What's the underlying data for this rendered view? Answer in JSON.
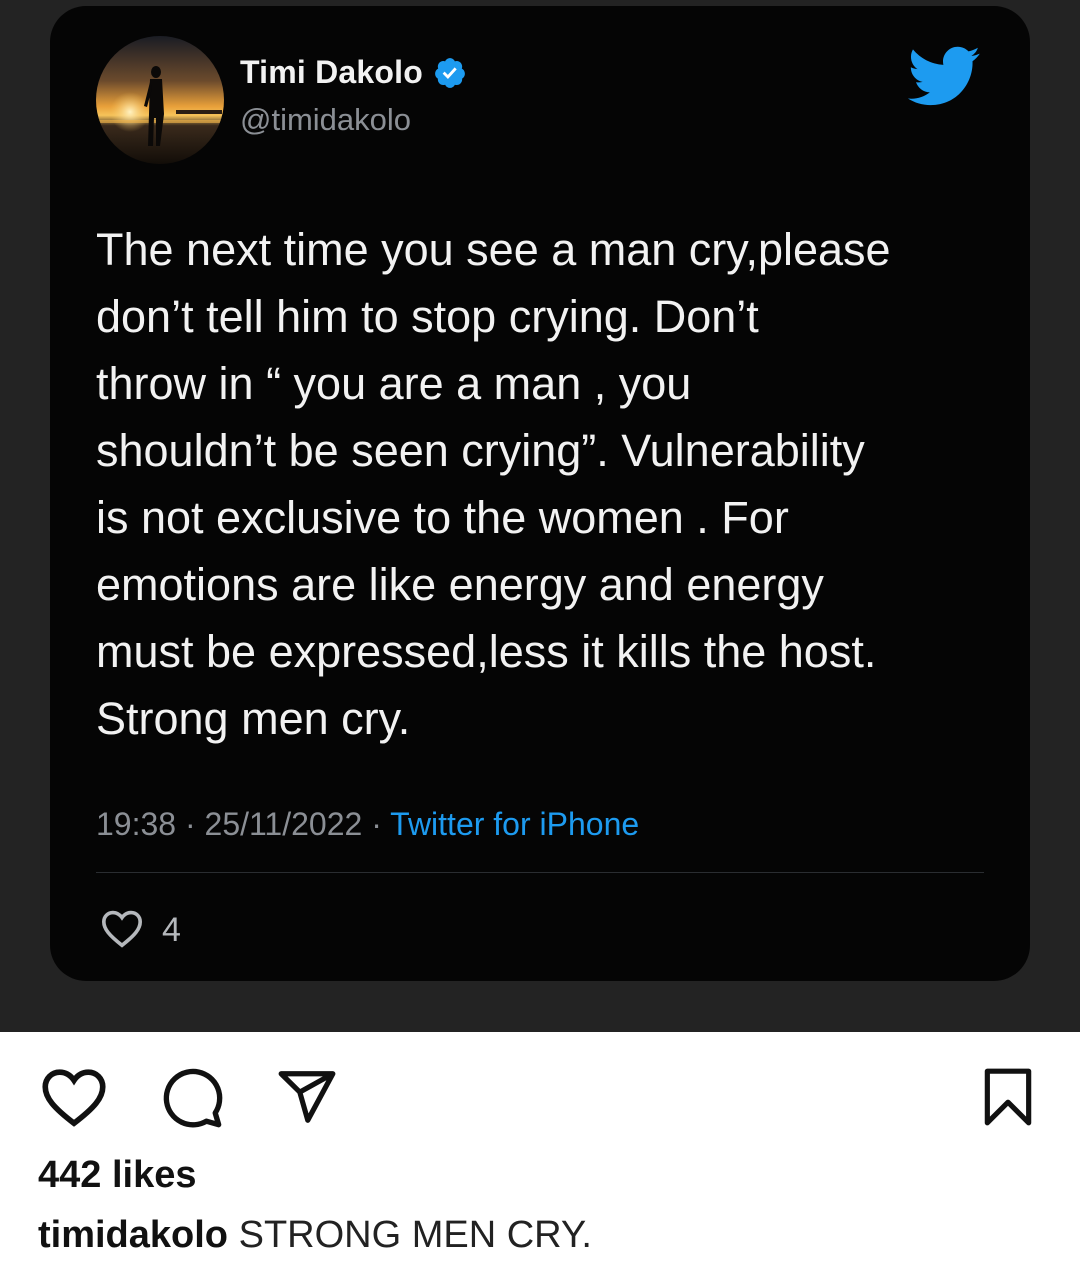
{
  "tweet": {
    "display_name": "Timi Dakolo",
    "handle": "@timidakolo",
    "text": "The next time you see a man cry,please\ndon’t tell him to stop crying. Don’t\nthrow in “ you are a man , you\nshouldn’t be seen crying”. Vulnerability\nis not exclusive to the women . For\nemotions are like energy and energy\nmust be expressed,less it kills the host.\nStrong men cry.",
    "time": "19:38",
    "date": "25/11/2022",
    "separator": "·",
    "source": "Twitter for iPhone",
    "like_count": "4",
    "icons": {
      "verified": "verified-badge-icon",
      "logo": "twitter-bird-icon",
      "like": "heart-outline-icon"
    },
    "colors": {
      "card_background": "#050505",
      "accent": "#1d9bf0",
      "secondary_text": "#8b8f95"
    }
  },
  "post": {
    "likes": "442 likes",
    "caption_username": "timidakolo",
    "caption_text": "STRONG MEN CRY.",
    "icons": {
      "like": "heart-icon",
      "comment": "comment-icon",
      "share": "paper-plane-icon",
      "save": "bookmark-icon"
    }
  }
}
